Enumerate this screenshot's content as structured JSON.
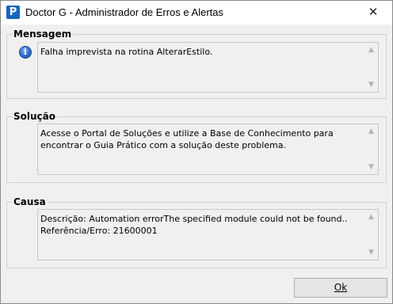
{
  "window": {
    "title": "Doctor G - Administrador de Erros e Alertas",
    "app_icon_glyph": "P",
    "close_glyph": "✕"
  },
  "mensagem": {
    "label": "Mensagem",
    "icon": "info-icon",
    "icon_glyph": "i",
    "text": "Falha imprevista na rotina AlterarEstilo."
  },
  "solucao": {
    "label": "Solução",
    "text": "Acesse o Portal de Soluções e utilize a Base de Conhecimento para encontrar o Guia Prático com a solução deste problema."
  },
  "causa": {
    "label": "Causa",
    "line1": "Descrição: Automation errorThe specified module could not be found..",
    "line2": "Referência/Erro: 21600001"
  },
  "scroll": {
    "up_glyph": "▲",
    "down_glyph": "▼"
  },
  "ok_button": {
    "label": "Ok"
  },
  "colors": {
    "accent": "#1565c0",
    "info_icon": "#2a6ad0"
  }
}
